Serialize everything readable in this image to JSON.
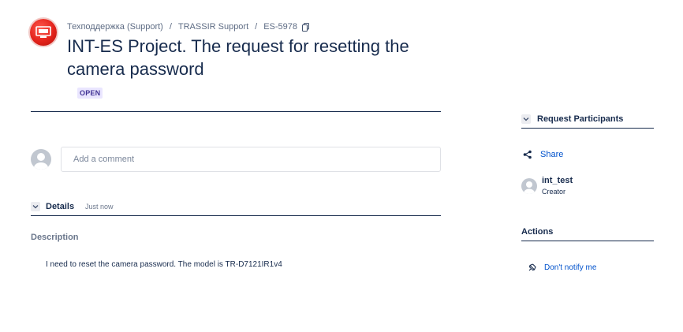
{
  "breadcrumb": {
    "service_desk": "Техподдержка (Support)",
    "separator": "/",
    "project": "TRASSIR Support",
    "issue_key": "ES-5978"
  },
  "request": {
    "title": "INT-ES Project. The request for resetting the camera password",
    "status": "OPEN"
  },
  "comment": {
    "placeholder": "Add a comment"
  },
  "details": {
    "label": "Details",
    "timestamp": "Just now",
    "description_label": "Description",
    "description_text": "I need to reset the camera password. The model is TR-D7121IR1v4"
  },
  "sidebar": {
    "participants_heading": "Request Participants",
    "share_label": "Share",
    "participant": {
      "name": "int_test",
      "role": "Creator"
    },
    "actions_heading": "Actions",
    "notify_label": "Don't notify me"
  },
  "colors": {
    "link": "#0052cc",
    "status_bg": "#eae6ff",
    "status_text": "#403294",
    "brand_red": "#e3231b"
  },
  "icons": {
    "project": "project-logo-icon",
    "copy": "copy-icon",
    "chevron": "chevron-down-icon",
    "share": "share-icon",
    "notify": "notification-off-icon",
    "avatar": "user-avatar-icon"
  }
}
